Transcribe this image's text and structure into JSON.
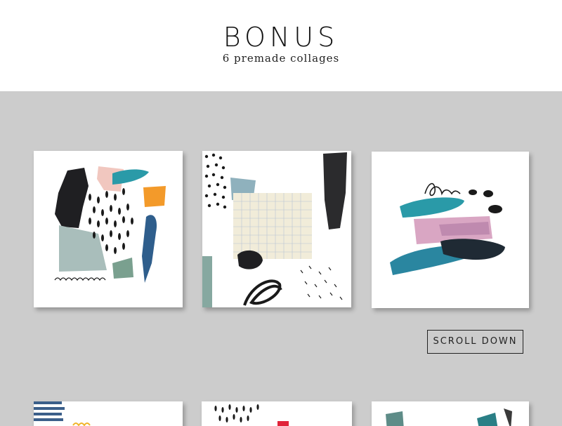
{
  "header": {
    "title": "BONUS",
    "subtitle": "6 premade collages"
  },
  "actions": {
    "scroll_label": "SCROLL DOWN"
  },
  "colors": {
    "page_bg": "#cccccc",
    "card_bg": "#ffffff",
    "teal": "#2a9aa8",
    "pink": "#d9a6c3",
    "orange": "#f39a2a",
    "sage": "#9fb5b0",
    "ink": "#1a1a1a"
  },
  "collages": [
    {
      "name": "collage-1"
    },
    {
      "name": "collage-2"
    },
    {
      "name": "collage-3"
    },
    {
      "name": "collage-4"
    },
    {
      "name": "collage-5"
    },
    {
      "name": "collage-6"
    }
  ]
}
